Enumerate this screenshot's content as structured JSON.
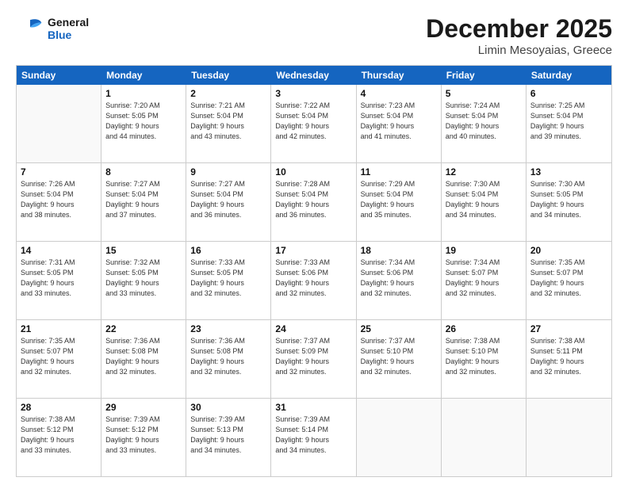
{
  "logo": {
    "line1": "General",
    "line2": "Blue"
  },
  "title": "December 2025",
  "subtitle": "Limin Mesoyaias, Greece",
  "days": [
    "Sunday",
    "Monday",
    "Tuesday",
    "Wednesday",
    "Thursday",
    "Friday",
    "Saturday"
  ],
  "weeks": [
    [
      {
        "day": "",
        "empty": true
      },
      {
        "day": "1",
        "sunrise": "7:20 AM",
        "sunset": "5:05 PM",
        "daylight": "9 hours and 44 minutes."
      },
      {
        "day": "2",
        "sunrise": "7:21 AM",
        "sunset": "5:04 PM",
        "daylight": "9 hours and 43 minutes."
      },
      {
        "day": "3",
        "sunrise": "7:22 AM",
        "sunset": "5:04 PM",
        "daylight": "9 hours and 42 minutes."
      },
      {
        "day": "4",
        "sunrise": "7:23 AM",
        "sunset": "5:04 PM",
        "daylight": "9 hours and 41 minutes."
      },
      {
        "day": "5",
        "sunrise": "7:24 AM",
        "sunset": "5:04 PM",
        "daylight": "9 hours and 40 minutes."
      },
      {
        "day": "6",
        "sunrise": "7:25 AM",
        "sunset": "5:04 PM",
        "daylight": "9 hours and 39 minutes."
      }
    ],
    [
      {
        "day": "7",
        "sunrise": "7:26 AM",
        "sunset": "5:04 PM",
        "daylight": "9 hours and 38 minutes."
      },
      {
        "day": "8",
        "sunrise": "7:27 AM",
        "sunset": "5:04 PM",
        "daylight": "9 hours and 37 minutes."
      },
      {
        "day": "9",
        "sunrise": "7:27 AM",
        "sunset": "5:04 PM",
        "daylight": "9 hours and 36 minutes."
      },
      {
        "day": "10",
        "sunrise": "7:28 AM",
        "sunset": "5:04 PM",
        "daylight": "9 hours and 36 minutes."
      },
      {
        "day": "11",
        "sunrise": "7:29 AM",
        "sunset": "5:04 PM",
        "daylight": "9 hours and 35 minutes."
      },
      {
        "day": "12",
        "sunrise": "7:30 AM",
        "sunset": "5:04 PM",
        "daylight": "9 hours and 34 minutes."
      },
      {
        "day": "13",
        "sunrise": "7:30 AM",
        "sunset": "5:05 PM",
        "daylight": "9 hours and 34 minutes."
      }
    ],
    [
      {
        "day": "14",
        "sunrise": "7:31 AM",
        "sunset": "5:05 PM",
        "daylight": "9 hours and 33 minutes."
      },
      {
        "day": "15",
        "sunrise": "7:32 AM",
        "sunset": "5:05 PM",
        "daylight": "9 hours and 33 minutes."
      },
      {
        "day": "16",
        "sunrise": "7:33 AM",
        "sunset": "5:05 PM",
        "daylight": "9 hours and 32 minutes."
      },
      {
        "day": "17",
        "sunrise": "7:33 AM",
        "sunset": "5:06 PM",
        "daylight": "9 hours and 32 minutes."
      },
      {
        "day": "18",
        "sunrise": "7:34 AM",
        "sunset": "5:06 PM",
        "daylight": "9 hours and 32 minutes."
      },
      {
        "day": "19",
        "sunrise": "7:34 AM",
        "sunset": "5:07 PM",
        "daylight": "9 hours and 32 minutes."
      },
      {
        "day": "20",
        "sunrise": "7:35 AM",
        "sunset": "5:07 PM",
        "daylight": "9 hours and 32 minutes."
      }
    ],
    [
      {
        "day": "21",
        "sunrise": "7:35 AM",
        "sunset": "5:07 PM",
        "daylight": "9 hours and 32 minutes."
      },
      {
        "day": "22",
        "sunrise": "7:36 AM",
        "sunset": "5:08 PM",
        "daylight": "9 hours and 32 minutes."
      },
      {
        "day": "23",
        "sunrise": "7:36 AM",
        "sunset": "5:08 PM",
        "daylight": "9 hours and 32 minutes."
      },
      {
        "day": "24",
        "sunrise": "7:37 AM",
        "sunset": "5:09 PM",
        "daylight": "9 hours and 32 minutes."
      },
      {
        "day": "25",
        "sunrise": "7:37 AM",
        "sunset": "5:10 PM",
        "daylight": "9 hours and 32 minutes."
      },
      {
        "day": "26",
        "sunrise": "7:38 AM",
        "sunset": "5:10 PM",
        "daylight": "9 hours and 32 minutes."
      },
      {
        "day": "27",
        "sunrise": "7:38 AM",
        "sunset": "5:11 PM",
        "daylight": "9 hours and 32 minutes."
      }
    ],
    [
      {
        "day": "28",
        "sunrise": "7:38 AM",
        "sunset": "5:12 PM",
        "daylight": "9 hours and 33 minutes."
      },
      {
        "day": "29",
        "sunrise": "7:39 AM",
        "sunset": "5:12 PM",
        "daylight": "9 hours and 33 minutes."
      },
      {
        "day": "30",
        "sunrise": "7:39 AM",
        "sunset": "5:13 PM",
        "daylight": "9 hours and 34 minutes."
      },
      {
        "day": "31",
        "sunrise": "7:39 AM",
        "sunset": "5:14 PM",
        "daylight": "9 hours and 34 minutes."
      },
      {
        "day": "",
        "empty": true
      },
      {
        "day": "",
        "empty": true
      },
      {
        "day": "",
        "empty": true
      }
    ]
  ],
  "labels": {
    "sunrise": "Sunrise:",
    "sunset": "Sunset:",
    "daylight": "Daylight:"
  }
}
